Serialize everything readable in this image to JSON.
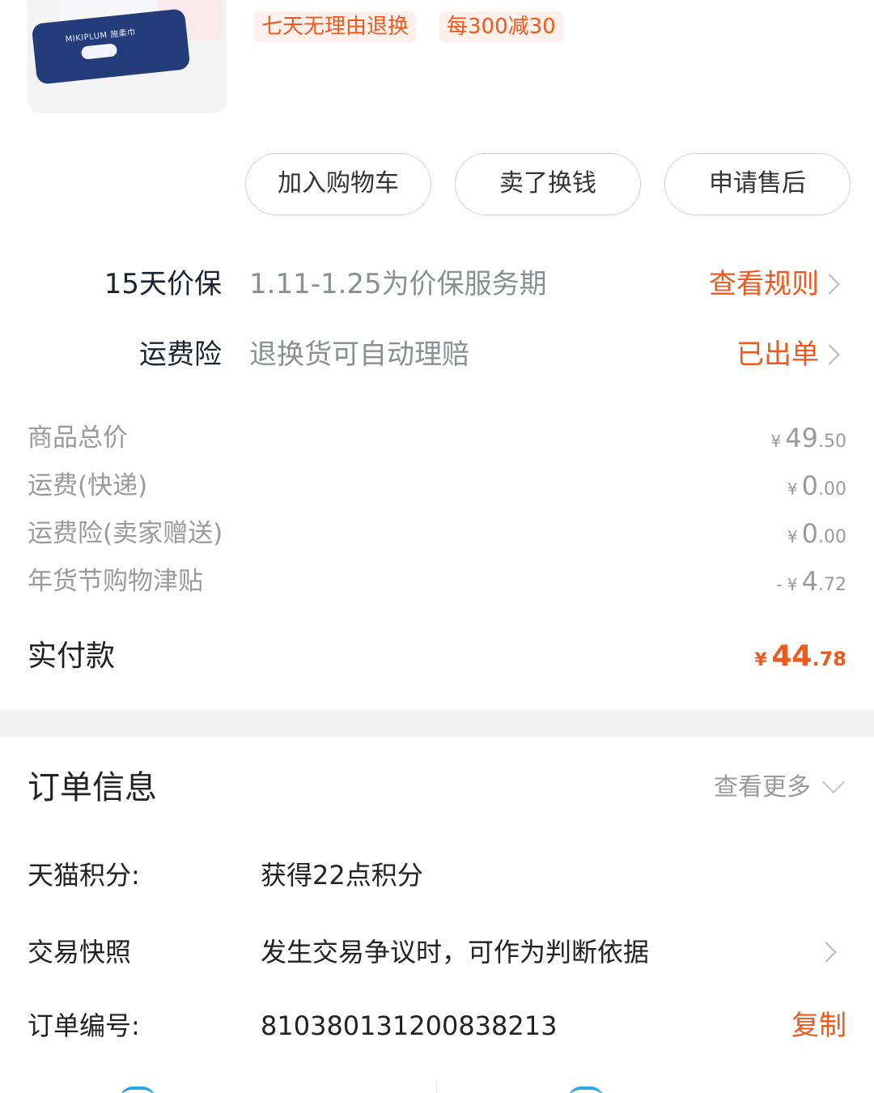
{
  "product": {
    "thumbnail_brand": "MIKIPLUM 施柔巾",
    "tags": [
      "七天无理由退换",
      "每300减30"
    ]
  },
  "actions": {
    "add_to_cart": "加入购物车",
    "resell": "卖了换钱",
    "after_sale": "申请售后"
  },
  "services": [
    {
      "title": "15天价保",
      "desc": "1.11-1.25为价保服务期",
      "link": "查看规则"
    },
    {
      "title": "运费险",
      "desc": "退换货可自动理赔",
      "link": "已出单"
    }
  ],
  "prices": [
    {
      "label": "商品总价",
      "currency": "¥",
      "integer": "49",
      "decimal": ".50"
    },
    {
      "label": "运费(快递)",
      "currency": "¥",
      "integer": "0",
      "decimal": ".00"
    },
    {
      "label": "运费险(卖家赠送)",
      "currency": "¥",
      "integer": "0",
      "decimal": ".00"
    },
    {
      "label": "年货节购物津贴",
      "currency": "- ¥",
      "integer": "4",
      "decimal": ".72"
    }
  ],
  "total": {
    "label": "实付款",
    "currency": "¥",
    "integer": "44",
    "decimal": ".78"
  },
  "order_info": {
    "title": "订单信息",
    "more": "查看更多",
    "rows": [
      {
        "label": "天猫积分:",
        "value": "获得22点积分"
      },
      {
        "label": "交易快照",
        "value": "发生交易争议时，可作为判断依据"
      },
      {
        "label": "订单编号:",
        "value": "8103801312008382​13",
        "action": "复制"
      }
    ]
  },
  "colors": {
    "accent": "#f0581d",
    "tag_bg": "#fff0eb",
    "muted": "#9a9a9a",
    "divider": "#f2f2f2"
  }
}
